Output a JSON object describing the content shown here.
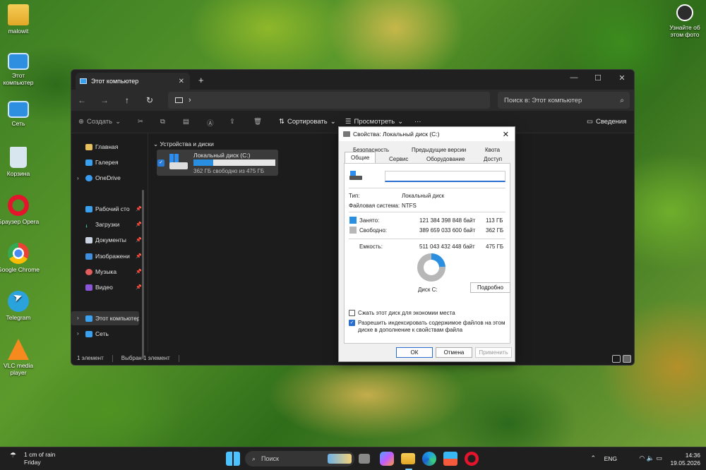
{
  "desktop": {
    "icons": [
      {
        "label": "malowit",
        "icon": "folder-icon"
      },
      {
        "label": "Этот компьютер",
        "icon": "monitor-icon"
      },
      {
        "label": "Сеть",
        "icon": "network-icon"
      },
      {
        "label": "Корзина",
        "icon": "recycle-bin-icon"
      },
      {
        "label": "Браузер Opera",
        "icon": "opera-icon"
      },
      {
        "label": "Google Chrome",
        "icon": "chrome-icon"
      },
      {
        "label": "Telegram",
        "icon": "telegram-icon"
      },
      {
        "label": "VLC media player",
        "icon": "vlc-icon"
      }
    ],
    "top_right_label": "Узнайте об этом фото"
  },
  "explorer": {
    "tab_title": "Этот компьютер",
    "address_sep": "›",
    "search_placeholder": "Поиск в: Этот компьютер",
    "toolbar": {
      "create": "Создать",
      "sort": "Сортировать",
      "view": "Просмотреть",
      "more": "···",
      "details": "Сведения"
    },
    "sidebar": {
      "home": "Главная",
      "gallery": "Галерея",
      "onedrive": "OneDrive",
      "desktop": "Рабочий сто",
      "downloads": "Загрузки",
      "documents": "Документы",
      "pictures": "Изображени",
      "music": "Музыка",
      "video": "Видео",
      "this_pc": "Этот компьютер",
      "network": "Сеть"
    },
    "section_header": "Устройства и диски",
    "drive": {
      "name": "Локальный диск (C:)",
      "free_text": "362 ГБ свободно из 475 ГБ",
      "used_fraction": 0.24
    },
    "status": {
      "items": "1 элемент",
      "selected": "Выбран 1 элемент"
    }
  },
  "properties": {
    "title": "Свойства: Локальный диск (C:)",
    "tabs_row1": [
      "Безопасность",
      "Предыдущие версии",
      "Квота"
    ],
    "tabs_row2": [
      "Общие",
      "Сервис",
      "Оборудование",
      "Доступ"
    ],
    "active_tab": "Общие",
    "name_value": "",
    "type_label": "Тип:",
    "type_value": "Локальный диск",
    "fs_label": "Файловая система:",
    "fs_value": "NTFS",
    "used_label": "Занято:",
    "used_bytes": "121 384 398 848 байт",
    "used_gb": "113 ГБ",
    "free_label": "Свободно:",
    "free_bytes": "389 659 033 600 байт",
    "free_gb": "362 ГБ",
    "capacity_label": "Емкость:",
    "capacity_bytes": "511 043 432 448 байт",
    "capacity_gb": "475 ГБ",
    "disk_label": "Диск C:",
    "details_button": "Подробно",
    "compress_label": "Сжать этот диск для экономии места",
    "compress_checked": false,
    "index_label_1": "Разрешить индексировать содержимое файлов на этом",
    "index_label_2": "диске в дополнение к свойствам файла",
    "index_checked": true,
    "ok": "ОК",
    "cancel": "Отмена",
    "apply": "Применить",
    "used_color": "#2a8fe0",
    "free_color": "#b7b7b7"
  },
  "taskbar": {
    "weather_1": "1 cm of rain",
    "weather_2": "Friday",
    "search": "Поиск",
    "lang": "ENG",
    "time": "14:36",
    "date": "19.05.2026"
  }
}
